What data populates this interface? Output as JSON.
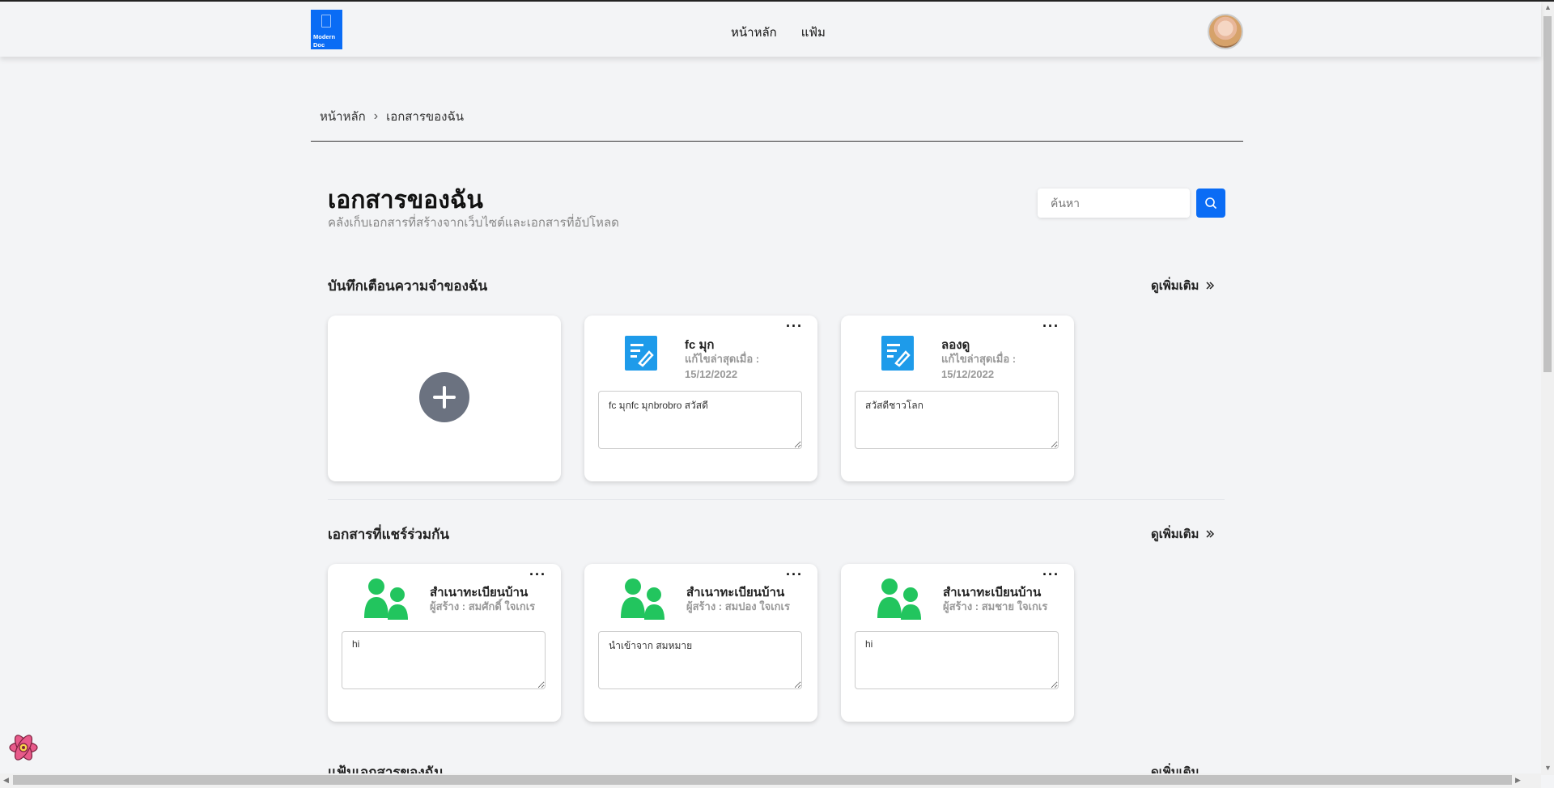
{
  "header": {
    "logo_text_line1": "Modern",
    "logo_text_line2": "Doc",
    "nav": [
      "หน้าหลัก",
      "แฟ้ม"
    ]
  },
  "breadcrumb": {
    "home": "หน้าหลัก",
    "current": "เอกสารของฉัน"
  },
  "page": {
    "title": "เอกสารของฉัน",
    "subtitle": "คลังเก็บเอกสารที่สร้างจากเว็บไซต์และเอกสารที่อัปโหลด",
    "search_placeholder": "ค้นหา"
  },
  "sections": {
    "notes": {
      "title": "บันทึกเตือนความจำของฉัน",
      "see_more": "ดูเพิ่มเติม",
      "cards": [
        {
          "title": "fc มุก",
          "meta_label": "แก้ไขล่าสุดเมื่อ :",
          "date": "15/12/2022",
          "content": "fc มุกfc มุกbrobro สวัสดี"
        },
        {
          "title": "ลองดู",
          "meta_label": "แก้ไขล่าสุดเมื่อ :",
          "date": "15/12/2022",
          "content": "สวัสดีชาวโลก"
        }
      ]
    },
    "shared": {
      "title": "เอกสารที่แชร์ร่วมกัน",
      "see_more": "ดูเพิ่มเติม",
      "cards": [
        {
          "title": "สำเนาทะเบียนบ้าน",
          "creator": "ผู้สร้าง : สมศักดิ์ ใจเกเร",
          "content": "hi"
        },
        {
          "title": "สำเนาทะเบียนบ้าน",
          "creator": "ผู้สร้าง : สมปอง ใจเกเร",
          "content": "นำเข้าจาก สมหมาย"
        },
        {
          "title": "สำเนาทะเบียนบ้าน",
          "creator": "ผู้สร้าง : สมชาย ใจเกเร",
          "content": "hi"
        }
      ]
    },
    "folders": {
      "title": "แฟ้มเอกสารของฉัน",
      "see_more": "ดูเพิ่มเติม"
    }
  },
  "colors": {
    "primary": "#0a6cf5",
    "note_icon": "#1e9bea",
    "share_icon": "#22c55e",
    "add_button": "#6b7280"
  }
}
